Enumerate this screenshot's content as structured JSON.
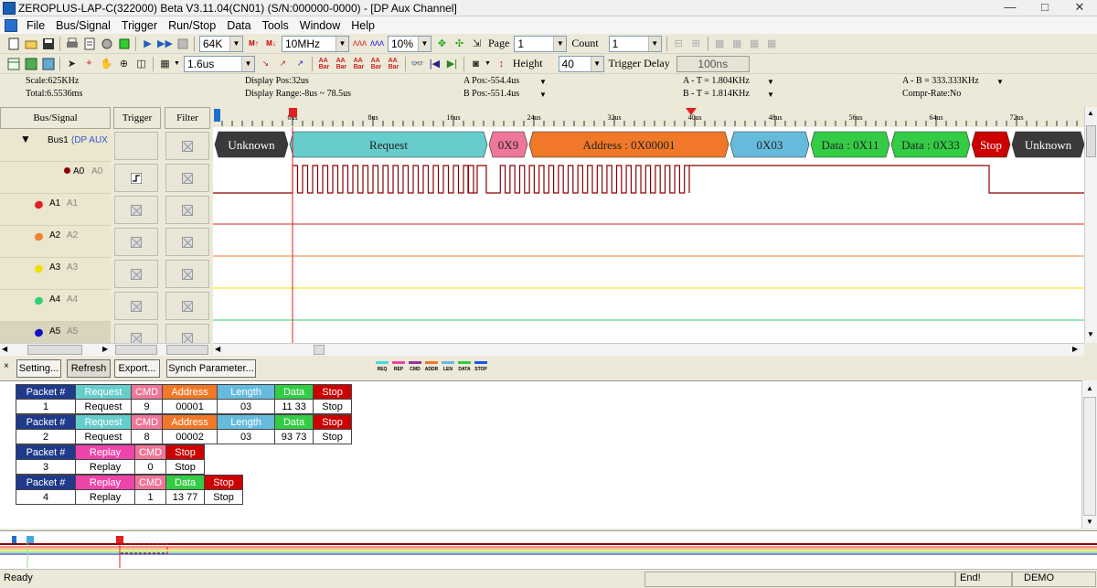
{
  "titlebar": {
    "title": "ZEROPLUS-LAP-C(322000) Beta V3.11.04(CN01) (S/N:000000-0000) - [DP Aux Channel]",
    "minimize": "—",
    "maximize": "□",
    "close": "✕"
  },
  "menu": [
    "File",
    "Bus/Signal",
    "Trigger",
    "Run/Stop",
    "Data",
    "Tools",
    "Window",
    "Help"
  ],
  "toolbar1": {
    "memory": "64K",
    "sample_rate": "10MHz",
    "zoom": "10%",
    "page_label": "Page",
    "page_value": "1",
    "count_label": "Count",
    "count_value": "1"
  },
  "toolbar2": {
    "resolution": "1.6us",
    "height_label": "Height",
    "height_value": "40",
    "trigger_delay_label": "Trigger Delay",
    "trigger_delay_value": "100ns"
  },
  "info": {
    "scale": "Scale:625KHz",
    "total": "Total:6.5536ms",
    "display_pos": "Display Pos:32us",
    "display_range": "Display Range:-8us ~ 78.5us",
    "a_pos": "A Pos:-554.4us",
    "b_pos": "B Pos:-551.4us",
    "a_t": "A - T = 1.804KHz",
    "b_t": "B - T = 1.814KHz",
    "a_b": "A - B = 333.333KHz",
    "compr": "Compr-Rate:No"
  },
  "signal_panel": {
    "col_bus_signal": "Bus/Signal",
    "col_trigger": "Trigger",
    "col_filter": "Filter",
    "bus_name": "Bus1",
    "bus_label": "(DP AUX C",
    "channels": [
      {
        "name": "A0",
        "alias": "A0",
        "color": "#8b0000"
      },
      {
        "name": "A1",
        "alias": "A1",
        "color": "#e02020"
      },
      {
        "name": "A2",
        "alias": "A2",
        "color": "#f08030"
      },
      {
        "name": "A3",
        "alias": "A3",
        "color": "#f0e000"
      },
      {
        "name": "A4",
        "alias": "A4",
        "color": "#30d070"
      },
      {
        "name": "A5",
        "alias": "A5",
        "color": "#1010c0"
      }
    ]
  },
  "ruler_ticks": [
    "0us",
    "8us",
    "16us",
    "24us",
    "32us",
    "40us",
    "48us",
    "56us",
    "64us",
    "72us"
  ],
  "bus_segments": [
    {
      "label": "Unknown",
      "color": "#3a3a3a",
      "text": "#ffffff"
    },
    {
      "label": "Request",
      "color": "#66cccc",
      "text": "#222222"
    },
    {
      "label": "0X9",
      "color": "#ee7799",
      "text": "#222222"
    },
    {
      "label": "Address : 0X00001",
      "color": "#f07828",
      "text": "#222222"
    },
    {
      "label": "0X03",
      "color": "#66bbdd",
      "text": "#222222"
    },
    {
      "label": "Data : 0X11",
      "color": "#33cc44",
      "text": "#222222"
    },
    {
      "label": "Data : 0X33",
      "color": "#33cc44",
      "text": "#222222"
    },
    {
      "label": "Stop",
      "color": "#cc0000",
      "text": "#ffffff"
    },
    {
      "label": "Unknown",
      "color": "#3a3a3a",
      "text": "#ffffff"
    }
  ],
  "proto_buttons": [
    "Setting...",
    "Refresh",
    "Export...",
    "Synch Parameter..."
  ],
  "legend": [
    {
      "label": "REQ",
      "color": "#44dddd"
    },
    {
      "label": "REP",
      "color": "#ee44aa"
    },
    {
      "label": "CMD",
      "color": "#993399"
    },
    {
      "label": "ADDR",
      "color": "#f07828"
    },
    {
      "label": "LEN",
      "color": "#66bbdd"
    },
    {
      "label": "DATA",
      "color": "#33cc44"
    },
    {
      "label": "STOP",
      "color": "#2255ee"
    }
  ],
  "packets": [
    {
      "num": "1",
      "headers": [
        "Packet #",
        "Request",
        "CMD",
        "Address",
        "Length",
        "Data",
        "Stop"
      ],
      "values": [
        "1",
        "Request",
        "9",
        "00001",
        "03",
        "11   33",
        "Stop"
      ]
    },
    {
      "num": "2",
      "headers": [
        "Packet #",
        "Request",
        "CMD",
        "Address",
        "Length",
        "Data",
        "Stop"
      ],
      "values": [
        "2",
        "Request",
        "8",
        "00002",
        "03",
        "93   73",
        "Stop"
      ]
    },
    {
      "num": "3",
      "headers": [
        "Packet #",
        "Replay",
        "CMD",
        "Stop"
      ],
      "values": [
        "3",
        "Replay",
        "0",
        "Stop"
      ]
    },
    {
      "num": "4",
      "headers": [
        "Packet #",
        "Replay",
        "CMD",
        "Data",
        "Stop"
      ],
      "values": [
        "4",
        "Replay",
        "1",
        "13   77",
        "Stop"
      ]
    }
  ],
  "status": {
    "left": "Ready",
    "end": "End!",
    "mode": "DEMO"
  }
}
